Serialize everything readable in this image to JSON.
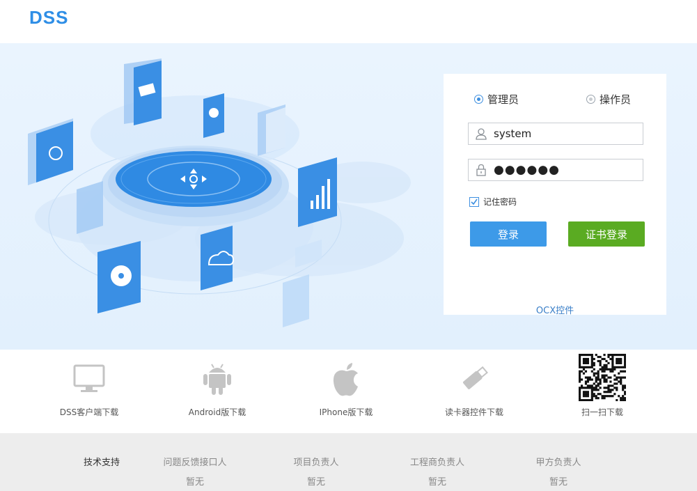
{
  "header": {
    "logo": "DSS"
  },
  "login": {
    "role_admin": "管理员",
    "role_operator": "操作员",
    "username_value": "system",
    "password_value": "●●●●●●",
    "remember_label": "记住密码",
    "login_button": "登录",
    "cert_login_button": "证书登录",
    "ocx_link": "OCX控件"
  },
  "downloads": [
    {
      "label": "DSS客户端下载",
      "icon": "monitor-icon"
    },
    {
      "label": "Android版下载",
      "icon": "android-icon"
    },
    {
      "label": "IPhone版下载",
      "icon": "apple-icon"
    },
    {
      "label": "读卡器控件下载",
      "icon": "usb-drive-icon"
    },
    {
      "label": "扫一扫下载",
      "icon": "qr-code-icon"
    }
  ],
  "footer": {
    "heading": "技术支持",
    "columns": [
      {
        "title": "问题反馈接口人",
        "value": "暂无"
      },
      {
        "title": "项目负责人",
        "value": "暂无"
      },
      {
        "title": "工程商负责人",
        "value": "暂无"
      },
      {
        "title": "甲方负责人",
        "value": "暂无"
      }
    ]
  },
  "colors": {
    "brand": "#2e8ee6",
    "login_button": "#3d9ae8",
    "cert_button": "#5aab22"
  }
}
